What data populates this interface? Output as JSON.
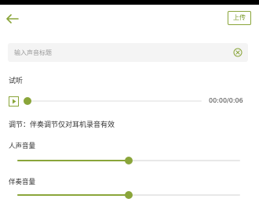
{
  "header": {
    "back_icon": "arrow-left-icon",
    "upload_label": "上传"
  },
  "title_input": {
    "placeholder": "输入声音标题",
    "value": "",
    "clear_icon": "circle-x-icon"
  },
  "preview": {
    "section_label": "试听",
    "play_icon": "play-icon",
    "time_text": "00:00/0:06",
    "progress": 0.0
  },
  "adjust": {
    "note": "调节：伴奏调节仅对耳机录音有效",
    "vocal": {
      "label": "人声音量",
      "level": 0.5
    },
    "accompaniment": {
      "label": "伴奏音量",
      "level": 0.5
    }
  },
  "colors": {
    "accent": "#8aa53a",
    "track_bg": "#e8e8e8"
  }
}
